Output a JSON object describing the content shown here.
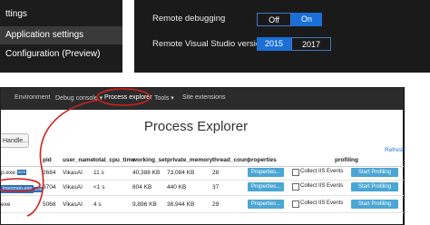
{
  "portal": {
    "nav": {
      "settings_label": "ttings",
      "app_settings_label": "Application settings",
      "config_label": "Configuration (Preview)"
    },
    "remote_debugging": {
      "label": "Remote debugging",
      "off": "Off",
      "on": "On",
      "selected": "On"
    },
    "remote_vs_version": {
      "label": "Remote Visual Studio version",
      "v2015": "2015",
      "v2017": "2017",
      "selected": "2015"
    },
    "colors": {
      "accent": "#1b6fd6",
      "panel_bg": "#1a1a1a"
    }
  },
  "kudu": {
    "navbar": {
      "environment": "Environment",
      "debug_console": "Debug console ▾",
      "process_explorer": "Process explorer",
      "tools": "Tools ▾",
      "site_extensions": "Site extensions"
    },
    "title": "Process Explorer",
    "handle_button": "Handle...",
    "refresh": "Refresh",
    "columns": {
      "pid": "pid",
      "user_name": "user_name",
      "total_cpu_time": "total_cpu_time",
      "working_set": "working_set",
      "private_memory": "private_memory",
      "thread_count": "thread_count",
      "properties": "properties",
      "profiling": "profiling"
    },
    "rows": [
      {
        "name": "p.exe",
        "badge": "scm",
        "pid": "2684",
        "user": "VikasAI",
        "cpu": "11 s",
        "ws": "40,388 KB",
        "pm": "73,084 KB",
        "threads": "28",
        "properties": "Properties...",
        "iis": "Collect IIS Events",
        "profile": "Start Profiling"
      },
      {
        "name": "irsvcmon.exe",
        "badge": "scm",
        "pid": "3704",
        "user": "VikasAI",
        "cpu": "<1 s",
        "ws": "804 KB",
        "pm": "440 KB",
        "threads": "37",
        "properties": "Properties...",
        "iis": "Collect IIS Events",
        "profile": "Start Profiling"
      },
      {
        "name": "exe",
        "badge": "",
        "pid": "5068",
        "user": "VikasAI",
        "cpu": "4 s",
        "ws": "9,896 KB",
        "pm": "38,944 KB",
        "threads": "29",
        "properties": "Properties...",
        "iis": "Collect IIS Events",
        "profile": "Start Profiling"
      }
    ],
    "colors": {
      "button": "#4aa6d4",
      "navbar": "#2b2b2b",
      "annotation": "#d02020"
    }
  }
}
